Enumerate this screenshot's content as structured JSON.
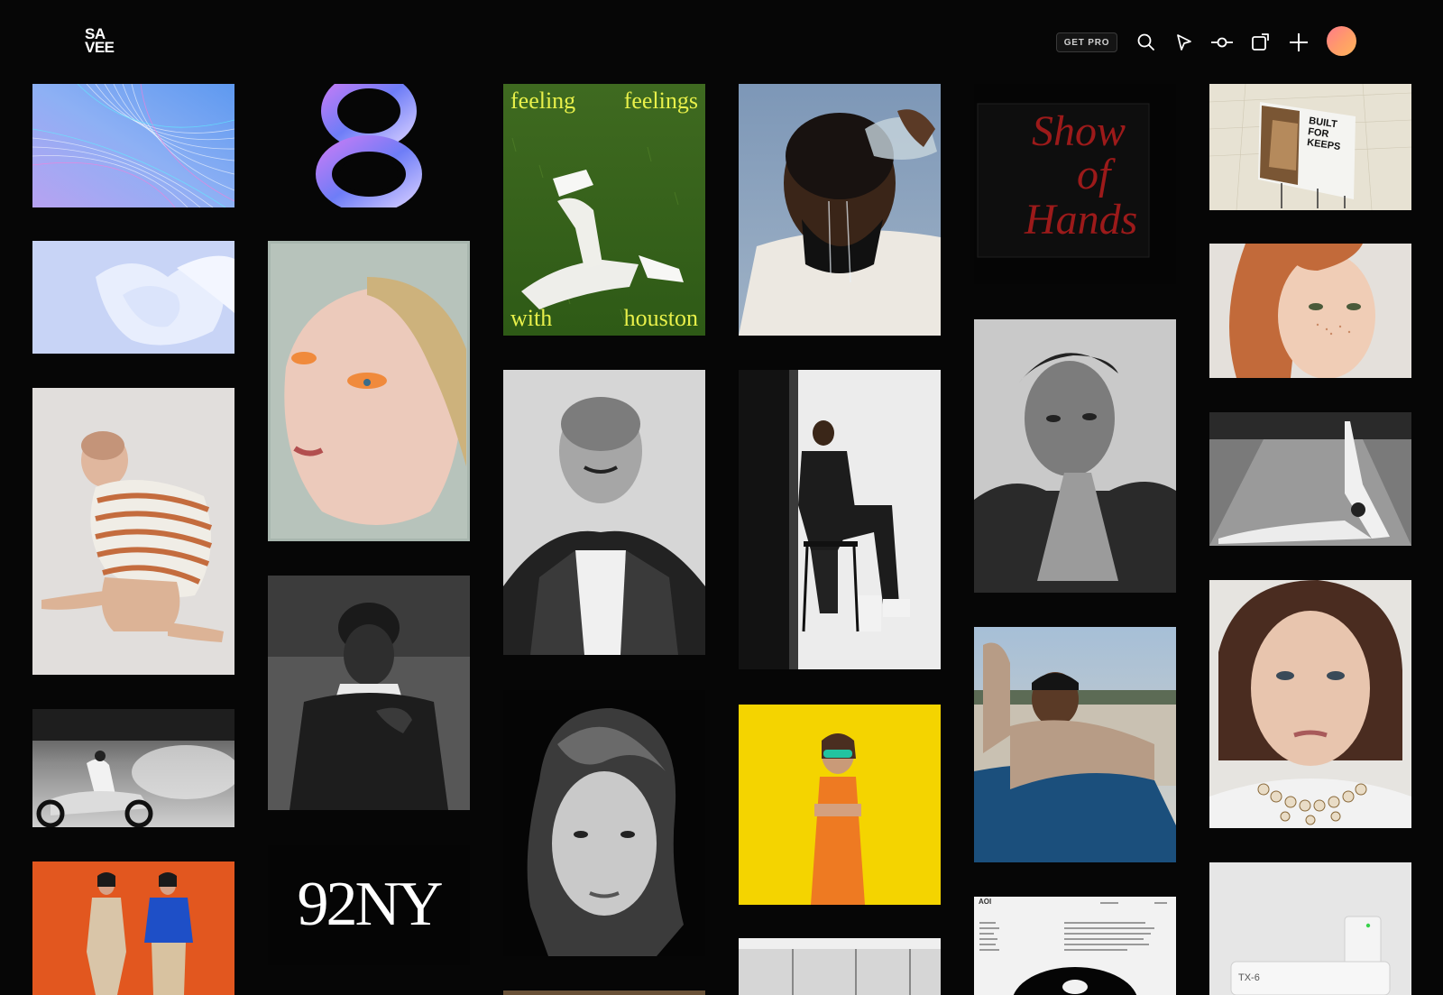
{
  "app": {
    "logo_line1": "SA",
    "logo_line2": "VEE"
  },
  "header": {
    "get_pro_label": "GET PRO",
    "icons": [
      "search-icon",
      "cursor-icon",
      "commit-icon",
      "board-icon",
      "plus-icon"
    ]
  },
  "colors": {
    "background": "#060606",
    "poster_text": "#e8f04a",
    "yellow_backdrop": "#f4d400",
    "orange_backdrop": "#e2571f"
  },
  "tiles": {
    "feeling_poster": {
      "top_left": "feeling",
      "top_right": "feelings",
      "bottom_left": "with",
      "bottom_right": "houston"
    },
    "show_of_hands": {
      "line1": "Show",
      "line2": "of",
      "line3": "Hands"
    },
    "billboard": {
      "line1": "BUILT",
      "line2": "FOR",
      "line3": "KEEPS"
    },
    "ny92": {
      "text": "92NY"
    },
    "device": {
      "label": "TX-6"
    },
    "document": {
      "brand": "AOI"
    }
  }
}
